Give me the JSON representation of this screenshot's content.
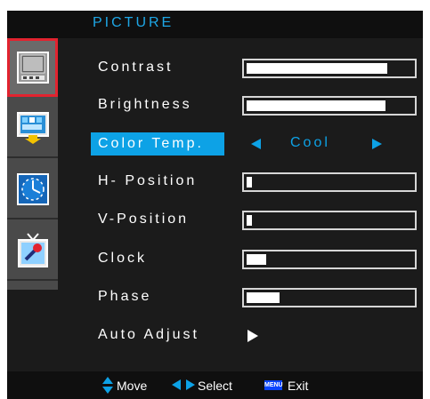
{
  "osd": {
    "title": "PICTURE",
    "sidebar": [
      {
        "name": "picture",
        "icon": "picture-icon",
        "selected": true
      },
      {
        "name": "color",
        "icon": "color-adjust-icon",
        "selected": false
      },
      {
        "name": "position",
        "icon": "clock-icon",
        "selected": false
      },
      {
        "name": "setup",
        "icon": "setup-tv-icon",
        "selected": false
      }
    ],
    "items": {
      "contrast": {
        "label": "Contrast",
        "level": 0.85
      },
      "brightness": {
        "label": "Brightness",
        "level": 0.84
      },
      "color_temp": {
        "label": "Color Temp.",
        "value": "Cool"
      },
      "h_position": {
        "label": "H- Position",
        "level": 0.03
      },
      "v_position": {
        "label": "V-Position",
        "level": 0.03
      },
      "clock": {
        "label": "Clock",
        "level": 0.12
      },
      "phase": {
        "label": "Phase",
        "level": 0.2
      },
      "auto_adjust": {
        "label": "Auto Adjust"
      }
    },
    "footer": {
      "move_label": "Move",
      "select_label": "Select",
      "menu_key_label": "MENU",
      "exit_label": "Exit"
    },
    "colors": {
      "accent": "#0da2e6",
      "selected_border": "#e2232f",
      "menu_key": "#0a45ff"
    }
  }
}
